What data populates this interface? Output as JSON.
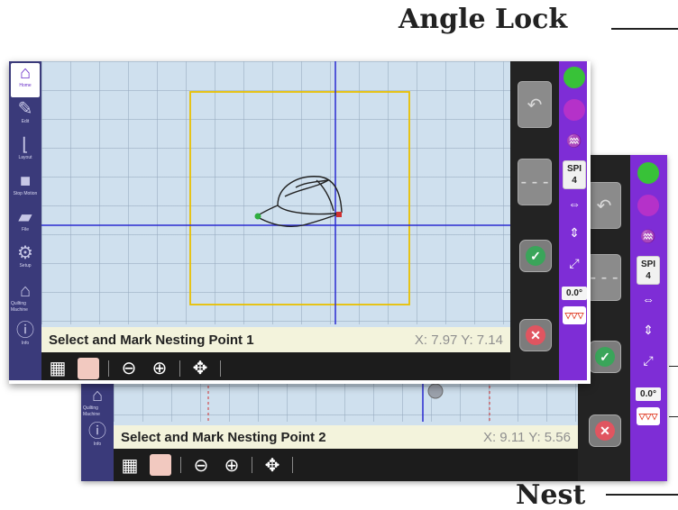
{
  "titles": {
    "top": "Angle Lock",
    "bottom": "Nest"
  },
  "nav": {
    "items": [
      {
        "label": "Home",
        "icon": "home-icon"
      },
      {
        "label": "Edit",
        "icon": "pencil-icon"
      },
      {
        "label": "Layout",
        "icon": "layout-icon"
      },
      {
        "label": "Stop Motion",
        "icon": "camera-icon"
      },
      {
        "label": "File",
        "icon": "folder-icon"
      },
      {
        "label": "Setup",
        "icon": "gears-icon"
      },
      {
        "label": "Quilting Machine",
        "icon": "sewing-machine-icon"
      },
      {
        "label": "Info",
        "icon": "info-icon"
      }
    ]
  },
  "front_screen": {
    "status_message": "Select and Mark Nesting Point 1",
    "coords": "X: 7.97 Y: 7.14",
    "spi_label": "SPI",
    "spi_value": "4",
    "angle": "0.0°"
  },
  "back_screen": {
    "status_message": "Select and Mark Nesting Point 2",
    "coords": "X: 9.11 Y: 5.56",
    "spi_label": "SPI",
    "spi_value": "4",
    "angle": "0.0°"
  },
  "colors": {
    "nav_bg": "#3a3a7a",
    "accent_purple": "#7e2dd6",
    "canvas": "#cfe0ee",
    "guide_line": "#2a2ad0",
    "bounding_box": "#e8c000",
    "status_green": "#38c238",
    "status_magenta": "#b531c9"
  }
}
